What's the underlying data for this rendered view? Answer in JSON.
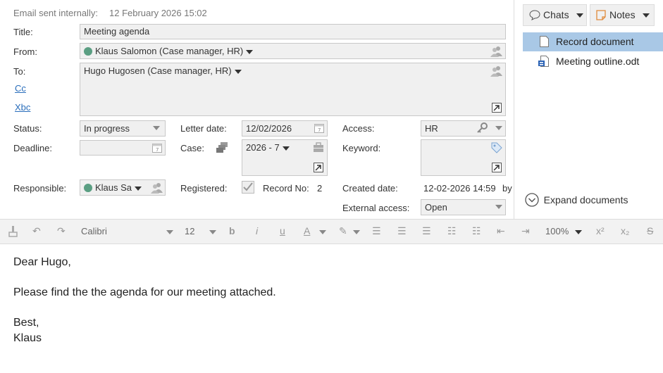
{
  "header": {
    "sent_label": "Email sent internally:",
    "sent_date": "12 February 2026 15:02"
  },
  "form": {
    "title_label": "Title:",
    "title_value": "Meeting agenda",
    "from_label": "From:",
    "from_value": "Klaus Salomon (Case manager, HR)",
    "to_label": "To:",
    "to_value": "Hugo Hugosen (Case manager, HR)",
    "cc_link": "Cc",
    "bcc_link": "Xbc",
    "status_label": "Status:",
    "status_value": "In progress",
    "letter_date_label": "Letter date:",
    "letter_date_value": "12/02/2026",
    "access_label": "Access:",
    "access_value": "HR",
    "deadline_label": "Deadline:",
    "deadline_value": "",
    "case_label": "Case:",
    "case_value": "2026 - 7",
    "keyword_label": "Keyword:",
    "keyword_value": "",
    "responsible_label": "Responsible:",
    "responsible_value": "Klaus Sa",
    "registered_label": "Registered:",
    "registered_checked": true,
    "record_no_label": "Record No:",
    "record_no_value": "2",
    "created_date_label": "Created date:",
    "created_date_value": "12-02-2026 14:59",
    "created_by_fragment": "by",
    "external_access_label": "External access:",
    "external_access_value": "Open"
  },
  "toolbar": {
    "font_name": "Calibri",
    "font_size": "12",
    "zoom": "100%"
  },
  "editor": {
    "lines": [
      "Dear Hugo,",
      "Please find the the agenda for our meeting attached.",
      "Best,",
      "Klaus"
    ]
  },
  "right_panel": {
    "chats_button": "Chats",
    "notes_button": "Notes",
    "documents": [
      {
        "name": "Record document",
        "selected": true,
        "icon": "page-icon"
      },
      {
        "name": "Meeting outline.odt",
        "selected": false,
        "icon": "odt-file-icon"
      }
    ],
    "expand_label": "Expand documents"
  },
  "colors": {
    "selection": "#a9c8e6",
    "link": "#2a6ebb",
    "status_dot": "#5a9e82",
    "notes_icon": "#e08a3a"
  }
}
